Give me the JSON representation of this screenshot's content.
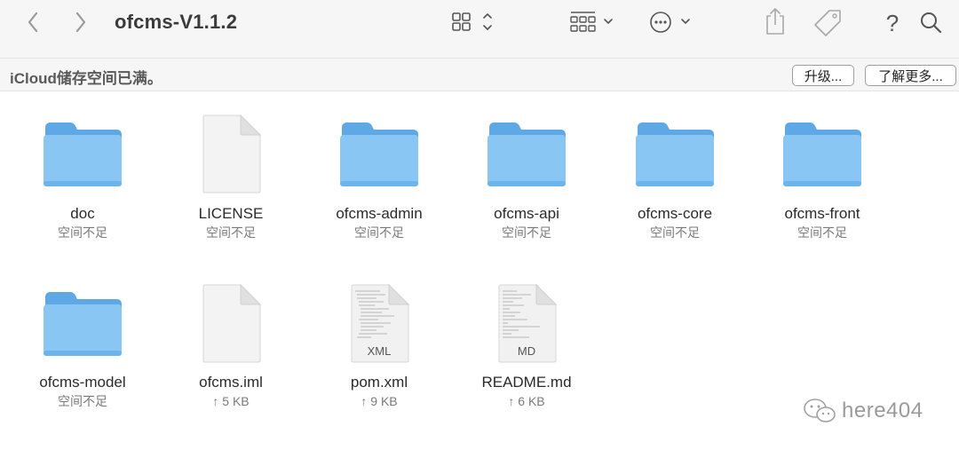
{
  "window": {
    "title": "ofcms-V1.1.2"
  },
  "toolbar": {
    "back_icon": "chevron-left-icon",
    "forward_icon": "chevron-right-icon",
    "view_icon": "grid-view-icon",
    "group_icon": "group-by-icon",
    "action_icon": "ellipsis-circle-icon",
    "share_icon": "share-icon",
    "tag_icon": "tag-icon",
    "help_label": "?",
    "search_icon": "search-icon"
  },
  "banner": {
    "message": "iCloud储存空间已满。",
    "upgrade_label": "升级...",
    "learn_more_label": "了解更多..."
  },
  "items": [
    {
      "name": "doc",
      "sub": "空间不足",
      "kind": "folder"
    },
    {
      "name": "LICENSE",
      "sub": "空间不足",
      "kind": "document"
    },
    {
      "name": "ofcms-admin",
      "sub": "空间不足",
      "kind": "folder"
    },
    {
      "name": "ofcms-api",
      "sub": "空间不足",
      "kind": "folder"
    },
    {
      "name": "ofcms-core",
      "sub": "空间不足",
      "kind": "folder"
    },
    {
      "name": "ofcms-front",
      "sub": "空间不足",
      "kind": "folder"
    },
    {
      "name": "ofcms-model",
      "sub": "空间不足",
      "kind": "folder"
    },
    {
      "name": "ofcms.iml",
      "sub": "↑ 5 KB",
      "kind": "document"
    },
    {
      "name": "pom.xml",
      "sub": "↑ 9 KB",
      "kind": "xml-document",
      "badge": "XML"
    },
    {
      "name": "README.md",
      "sub": "↑ 6 KB",
      "kind": "md-document",
      "badge": "MD"
    }
  ],
  "watermark": {
    "text": "here404"
  },
  "colors": {
    "folder_body": "#8ac6f3",
    "folder_tab": "#5fa8e6",
    "toolbar_bg": "#f6f6f6"
  }
}
